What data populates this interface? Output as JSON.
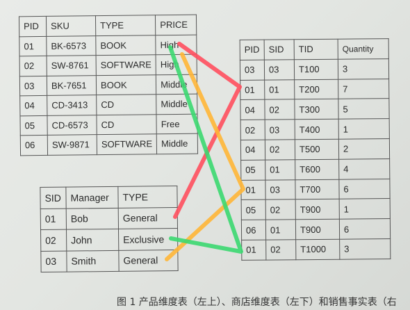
{
  "product_table": {
    "headers": [
      "PID",
      "SKU",
      "TYPE",
      "PRICE"
    ],
    "rows": [
      [
        "01",
        "BK-6573",
        "BOOK",
        "High"
      ],
      [
        "02",
        "SW-8761",
        "SOFTWARE",
        "High"
      ],
      [
        "03",
        "BK-7651",
        "BOOK",
        "Middle"
      ],
      [
        "04",
        "CD-3413",
        "CD",
        "Middle"
      ],
      [
        "05",
        "CD-6573",
        "CD",
        "Free"
      ],
      [
        "06",
        "SW-9871",
        "SOFTWARE",
        "Middle"
      ]
    ]
  },
  "store_table": {
    "headers": [
      "SID",
      "Manager",
      "TYPE"
    ],
    "rows": [
      [
        "01",
        "Bob",
        "General"
      ],
      [
        "02",
        "John",
        "Exclusive"
      ],
      [
        "03",
        "Smith",
        "General"
      ]
    ]
  },
  "sales_table": {
    "headers": [
      "PID",
      "SID",
      "TID",
      "Quantity"
    ],
    "rows": [
      [
        "03",
        "03",
        "T100",
        "3"
      ],
      [
        "01",
        "01",
        "T200",
        "7"
      ],
      [
        "04",
        "02",
        "T300",
        "5"
      ],
      [
        "02",
        "03",
        "T400",
        "1"
      ],
      [
        "04",
        "02",
        "T500",
        "2"
      ],
      [
        "05",
        "01",
        "T600",
        "4"
      ],
      [
        "01",
        "03",
        "T700",
        "6"
      ],
      [
        "05",
        "02",
        "T900",
        "1"
      ],
      [
        "06",
        "01",
        "T900",
        "6"
      ],
      [
        "01",
        "02",
        "T1000",
        "3"
      ]
    ]
  },
  "link_colors": {
    "red": "#ff4f5e",
    "orange": "#ffb637",
    "green": "#3bd870"
  },
  "caption": "图 1 产品维度表（左上）、商店维度表（左下）和销售事实表（右"
}
